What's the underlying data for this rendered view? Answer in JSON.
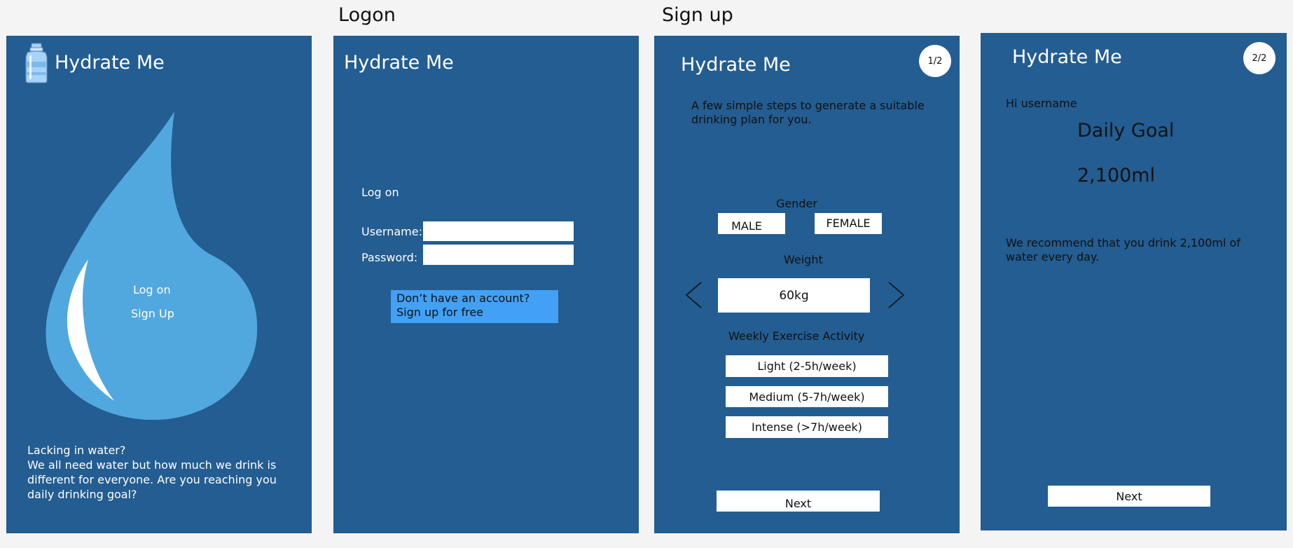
{
  "sections": {
    "logon_heading": "Logon",
    "signup_heading": "Sign up"
  },
  "app_name": "Hydrate Me",
  "welcome": {
    "logon_link": "Log on",
    "signup_link": "Sign Up",
    "tagline_question": "Lacking in water?",
    "tagline_body": "We all need water but how much we drink is different for everyone. Are you reaching you daily drinking goal?",
    "icons": {
      "logo": "water-bottle-icon",
      "hero": "water-drop-icon"
    },
    "colors": {
      "drop": "#51a8de",
      "panel": "#235d91"
    }
  },
  "logon": {
    "heading": "Log on",
    "username_label": "Username:",
    "password_label": "Password:",
    "username_value": "",
    "password_value": "",
    "signup_prompt_line1": "Don’t have an account?",
    "signup_prompt_line2": "Sign up for free",
    "colors": {
      "prompt_bg": "#42a1f5"
    }
  },
  "signup_step1": {
    "step": "1/2",
    "intro": "A few simple steps to generate a suitable drinking plan for you.",
    "gender_label": "Gender",
    "gender_options": [
      "MALE",
      "FEMALE"
    ],
    "weight_label": "Weight",
    "weight_value": "60kg",
    "icons": {
      "prev": "chevron-left-icon",
      "next": "chevron-right-icon"
    },
    "exercise_label": "Weekly Exercise Activity",
    "exercise_options": [
      "Light (2-5h/week)",
      "Medium (5-7h/week)",
      "Intense (>7h/week)"
    ],
    "next_label": "Next"
  },
  "signup_step2": {
    "step": "2/2",
    "greeting": "Hi username",
    "goal_title": "Daily Goal",
    "goal_value": "2,100ml",
    "recommendation": "We recommend that you drink 2,100ml of water every day.",
    "next_label": "Next"
  }
}
